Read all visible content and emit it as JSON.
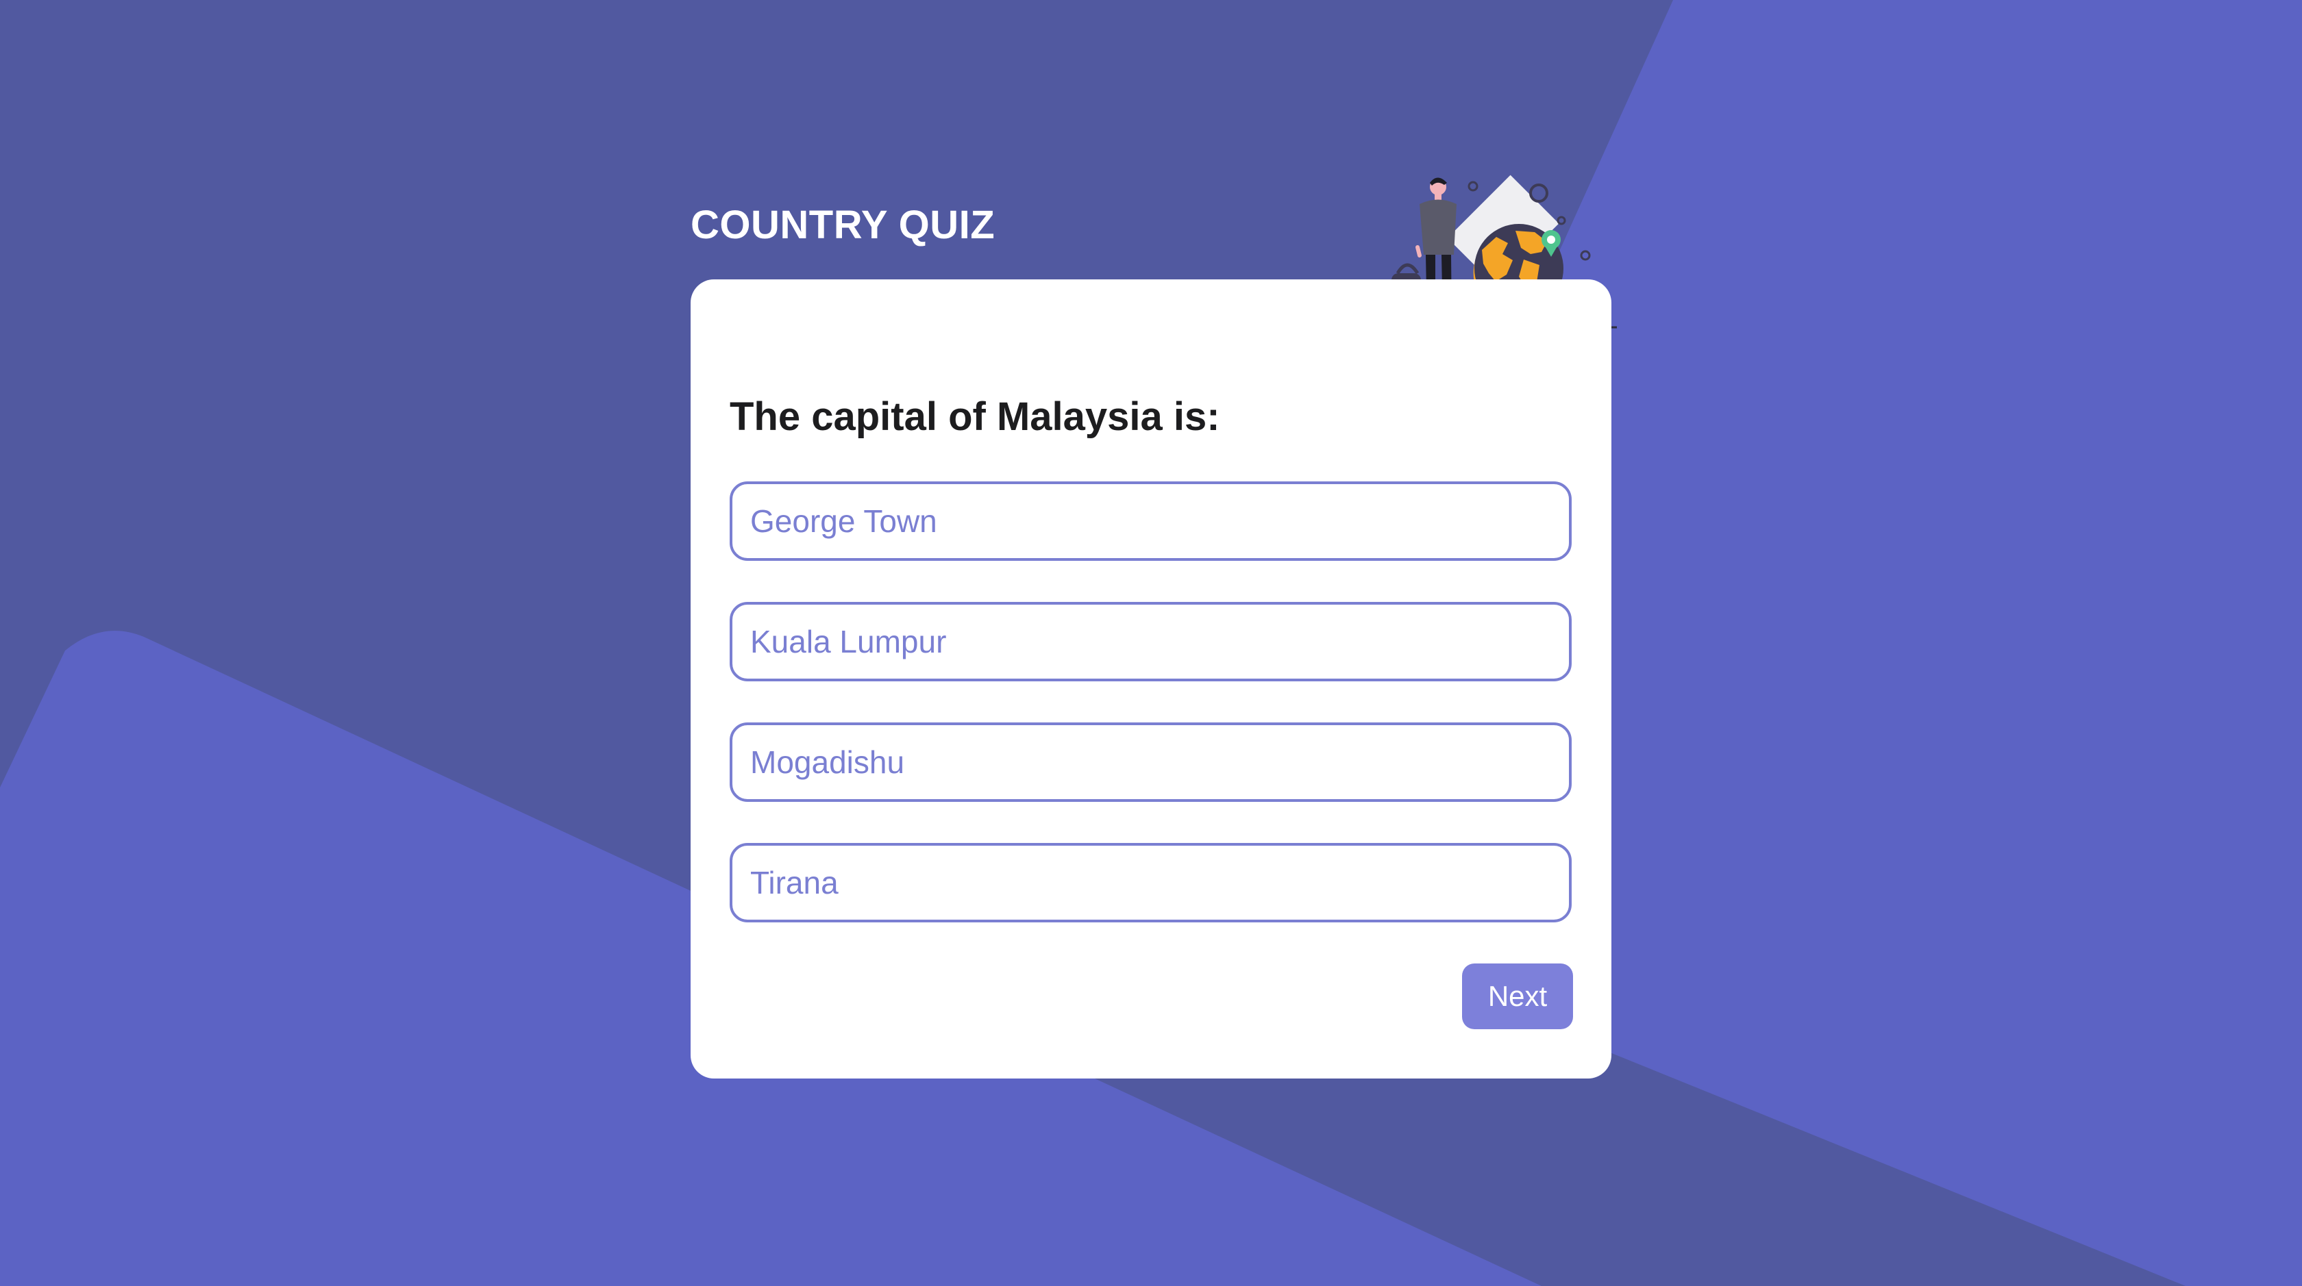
{
  "app": {
    "title": "COUNTRY QUIZ"
  },
  "quiz": {
    "question": "The capital of Malaysia is:",
    "options": [
      {
        "label": "George Town"
      },
      {
        "label": "Kuala Lumpur"
      },
      {
        "label": "Mogadishu"
      },
      {
        "label": "Tirana"
      }
    ],
    "next_label": "Next"
  },
  "colors": {
    "background": "#5159a0",
    "accent_background": "#5c63c4",
    "card": "#ffffff",
    "option_border": "#7a7fd2",
    "option_text": "#7a7fd2",
    "button": "#7d80da"
  },
  "icons": {
    "illustration": "traveler-with-globe-illustration"
  }
}
